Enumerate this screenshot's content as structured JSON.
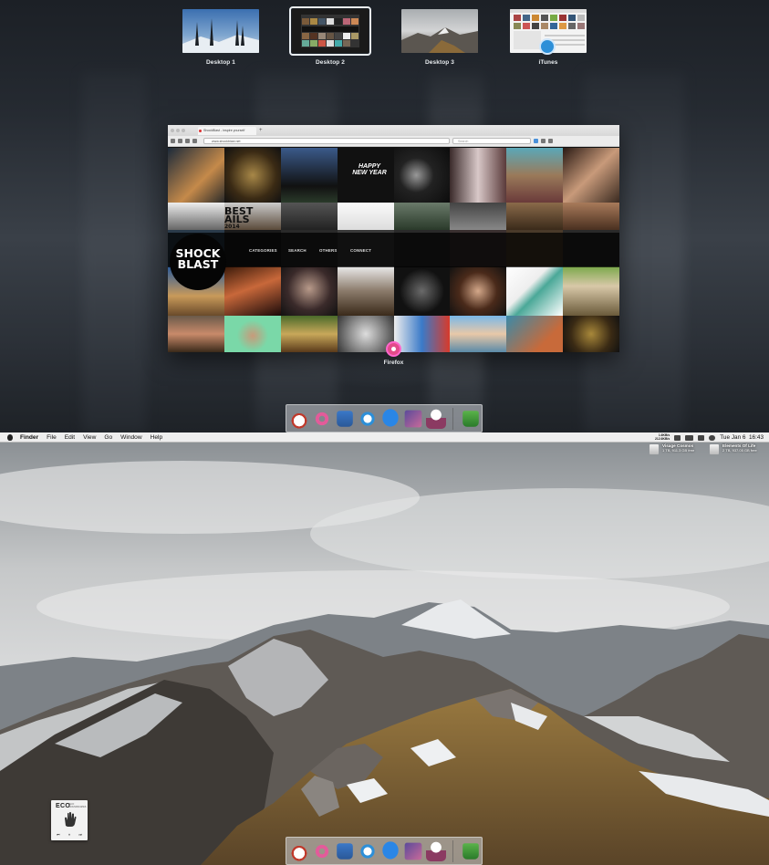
{
  "mission_control": {
    "spaces": [
      {
        "label": "Desktop 1",
        "active": false
      },
      {
        "label": "Desktop 2",
        "active": true
      },
      {
        "label": "Desktop 3",
        "active": false
      },
      {
        "label": "iTunes",
        "active": false
      }
    ],
    "window": {
      "app_label": "Firefox",
      "tab_title": "ShockBlast - inspire yourself",
      "url": "www.shockblast.net",
      "search_placeholder": "Search",
      "site_logo_line1": "SHOCK",
      "site_logo_line2": "BLAST",
      "nav_links": [
        "CATEGORIES",
        "SEARCH",
        "OTHERS",
        "CONNECT"
      ],
      "tile_text_newyear_1": "HAPPY",
      "tile_text_newyear_2": "NEW YEAR",
      "tile_text_best_1": "BEST",
      "tile_text_best_2": "AILS",
      "tile_text_best_3": "2014"
    }
  },
  "dock": {
    "apps": [
      {
        "icon": "tea-cup-icon",
        "color": "#c0392b"
      },
      {
        "icon": "donut-icon",
        "color": "#e35b9a"
      },
      {
        "icon": "jar-icon",
        "color": "#3a78c8"
      },
      {
        "icon": "ring-icon",
        "color": "#2d8fd8"
      },
      {
        "icon": "messages-icon",
        "color": "#2a86e6"
      },
      {
        "icon": "photos-icon",
        "color": "#6a4a8a"
      },
      {
        "icon": "cupcake-icon",
        "color": "#8b3a62"
      },
      {
        "icon": "trash-bucket-icon",
        "color": "#4aa33a"
      }
    ]
  },
  "menubar": {
    "app_name": "Finder",
    "items": [
      "File",
      "Edit",
      "View",
      "Go",
      "Window",
      "Help"
    ],
    "net_up": "1.6KB/s",
    "net_down": "212.6KB/s",
    "clock": "Tue Jan 6  16:43"
  },
  "desktop": {
    "drives": [
      {
        "name": "Visage Cosmos",
        "info": "1 TB, 911.3 GB free"
      },
      {
        "name": "Elements Of Life",
        "info": "2 TB, 937.05 GB free"
      }
    ],
    "widget": {
      "logo": "ECO",
      "subtitle": "ECO SOUNDSCAPES",
      "controls": [
        "⏮",
        "⏸",
        "⏭"
      ]
    }
  },
  "colors": {
    "accent": "#4a90d9",
    "dock_bg": "#cdd2d7",
    "menubar_bg": "#eeeeee"
  }
}
